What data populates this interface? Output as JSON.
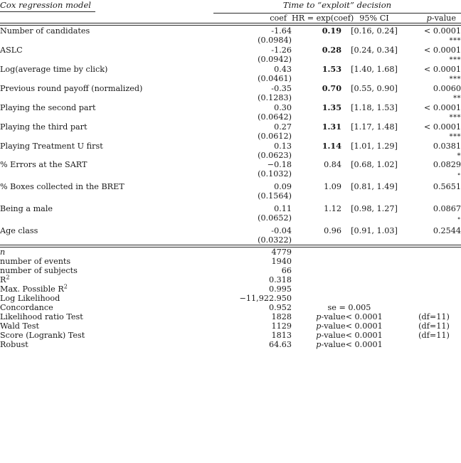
{
  "header": {
    "model_title": "Cox regression model",
    "span_title": "Time to “exploit” decision",
    "columns": {
      "coef": "coef",
      "hr": "HR = exp(coef)",
      "ci": "95% CI",
      "pvalue_prefix": "p",
      "pvalue_suffix": "-value"
    }
  },
  "rows": [
    {
      "label": "Number of candidates",
      "coef": "-1.64",
      "se": "(0.0984)",
      "hr": "0.19",
      "hr_bold": true,
      "ci": "[0.16, 0.24]",
      "pvalue": "< 0.0001",
      "stars": "***"
    },
    {
      "label": "ASLC",
      "coef": "-1.26",
      "se": "(0.0942)",
      "hr": "0.28",
      "hr_bold": true,
      "ci": "[0.24, 0.34]",
      "pvalue": "< 0.0001",
      "stars": "***"
    },
    {
      "label": "Log(average time by click)",
      "coef": "0.43",
      "se": "(0.0461)",
      "hr": "1.53",
      "hr_bold": true,
      "ci": "[1.40, 1.68]",
      "pvalue": "< 0.0001",
      "stars": "***"
    },
    {
      "label": "Previous round payoff (normalized)",
      "coef": "-0.35",
      "se": "(0.1283)",
      "hr": "0.70",
      "hr_bold": true,
      "ci": "[0.55, 0.90]",
      "pvalue": "0.0060",
      "stars": "**"
    },
    {
      "label": "Playing the second part",
      "coef": "0.30",
      "se": "(0.0642)",
      "hr": "1.35",
      "hr_bold": true,
      "ci": "[1.18, 1.53]",
      "pvalue": "< 0.0001",
      "stars": "***"
    },
    {
      "label": "Playing the third part",
      "coef": "0.27",
      "se": "(0.0612)",
      "hr": "1.31",
      "hr_bold": true,
      "ci": "[1.17, 1.48]",
      "pvalue": "< 0.0001",
      "stars": "***"
    },
    {
      "label": "Playing Treatment U first",
      "coef": "0.13",
      "se": "(0.0623)",
      "hr": "1.14",
      "hr_bold": true,
      "ci": "[1.01, 1.29]",
      "pvalue": "0.0381",
      "stars": "*"
    },
    {
      "label": "% Errors at the SART",
      "coef": "−0.18",
      "se": "(0.1032)",
      "hr": "0.84",
      "hr_bold": false,
      "ci": "[0.68, 1.02]",
      "pvalue": "0.0829",
      "stars": "∘"
    },
    {
      "label": "% Boxes collected in the BRET",
      "coef": "0.09",
      "se": "(0.1564)",
      "hr": "1.09",
      "hr_bold": false,
      "ci": "[0.81, 1.49]",
      "pvalue": "0.5651",
      "stars": ""
    },
    {
      "label": "Being a male",
      "coef": "0.11",
      "se": "(0.0652)",
      "hr": "1.12",
      "hr_bold": false,
      "ci": "[0.98, 1.27]",
      "pvalue": "0.0867",
      "stars": "∘"
    },
    {
      "label": "Age class",
      "coef": "-0.04",
      "se": "(0.0322)",
      "hr": "0.96",
      "hr_bold": false,
      "ci": "[0.91, 1.03]",
      "pvalue": "0.2544",
      "stars": ""
    }
  ],
  "summary": [
    {
      "label": "n",
      "label_italic": true,
      "value": "4779",
      "extra": "",
      "df": ""
    },
    {
      "label": "number of events",
      "label_italic": false,
      "value": "1940",
      "extra": "",
      "df": ""
    },
    {
      "label": "number of subjects",
      "label_italic": false,
      "value": "66",
      "extra": "",
      "df": ""
    },
    {
      "label": "R2",
      "label_italic": false,
      "value": "0.318",
      "extra": "",
      "df": ""
    },
    {
      "label": "Max. Possible R2",
      "label_italic": false,
      "value": "0.995",
      "extra": "",
      "df": ""
    },
    {
      "label": "Log Likelihood",
      "label_italic": false,
      "value": "−11,922.950",
      "extra": "",
      "df": ""
    },
    {
      "label": "Concordance",
      "label_italic": false,
      "value": "0.952",
      "extra": "se = 0.005",
      "df": ""
    },
    {
      "label": "Likelihood ratio Test",
      "label_italic": false,
      "value": "1828",
      "extra": "p-value< 0.0001",
      "df": "(df=11)"
    },
    {
      "label": "Wald Test",
      "label_italic": false,
      "value": "1129",
      "extra": "p-value< 0.0001",
      "df": "(df=11)"
    },
    {
      "label": "Score (Logrank) Test",
      "label_italic": false,
      "value": "1813",
      "extra": "p-value< 0.0001",
      "df": "(df=11)"
    },
    {
      "label": "Robust",
      "label_italic": false,
      "value": "64.63",
      "extra": "p-value< 0.0001",
      "df": ""
    }
  ]
}
